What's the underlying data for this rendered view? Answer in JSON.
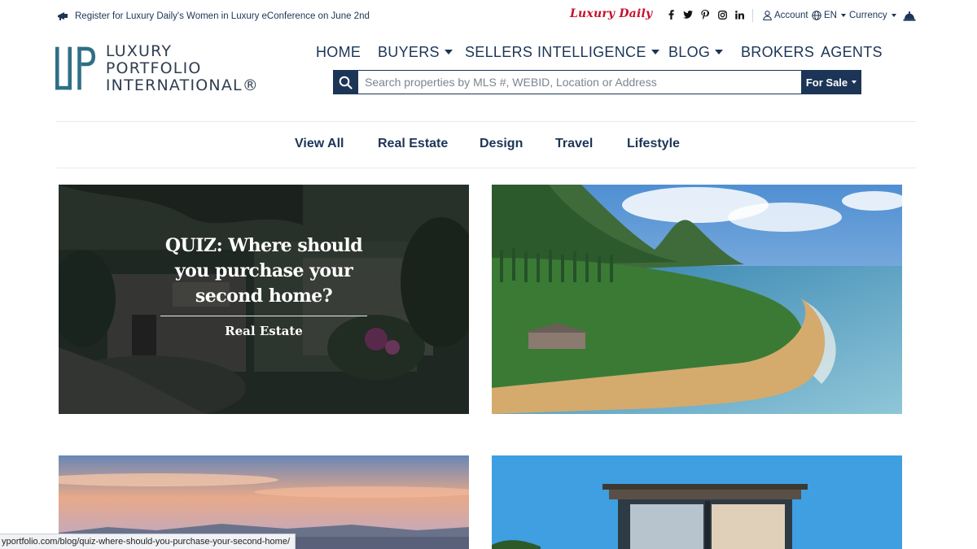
{
  "topbar": {
    "promo_text": "Register for Luxury Daily's Women in Luxury eConference on June 2nd",
    "luxury_daily": "Luxury Daily",
    "social": [
      {
        "icon": "facebook-icon",
        "glyph": "f"
      },
      {
        "icon": "twitter-icon",
        "glyph": "t"
      },
      {
        "icon": "pinterest-icon",
        "glyph": "p"
      },
      {
        "icon": "instagram-icon",
        "glyph": "i"
      },
      {
        "icon": "linkedin-icon",
        "glyph": "in"
      }
    ],
    "account_label": "Account",
    "language_label": "EN",
    "currency_label": "Currency"
  },
  "logo": {
    "line1": "LUXURY",
    "line2": "PORTFOLIO",
    "line3": "INTERNATIONAL®"
  },
  "nav": [
    {
      "label": "HOME",
      "dropdown": false
    },
    {
      "label": "BUYERS",
      "dropdown": true
    },
    {
      "label": "SELLERS",
      "dropdown": false
    },
    {
      "label": "INTELLIGENCE",
      "dropdown": true
    },
    {
      "label": "BLOG",
      "dropdown": true
    },
    {
      "label": "BROKERS",
      "dropdown": false
    },
    {
      "label": "AGENTS",
      "dropdown": false
    }
  ],
  "search": {
    "placeholder": "Search properties by MLS #, WEBID, Location or Address",
    "value": "",
    "mode_label": "For Sale"
  },
  "tabs": [
    "View All",
    "Real Estate",
    "Design",
    "Travel",
    "Lifestyle"
  ],
  "cards": [
    {
      "title": "QUIZ: Where should you purchase your second home?",
      "category": "Real Estate"
    }
  ],
  "status_url": "yportfolio.com/blog/quiz-where-should-you-purchase-your-second-home/",
  "colors": {
    "navy": "#1c3557",
    "logo_teal": "#2e6f86",
    "luxury_daily_red": "#c8102e"
  }
}
